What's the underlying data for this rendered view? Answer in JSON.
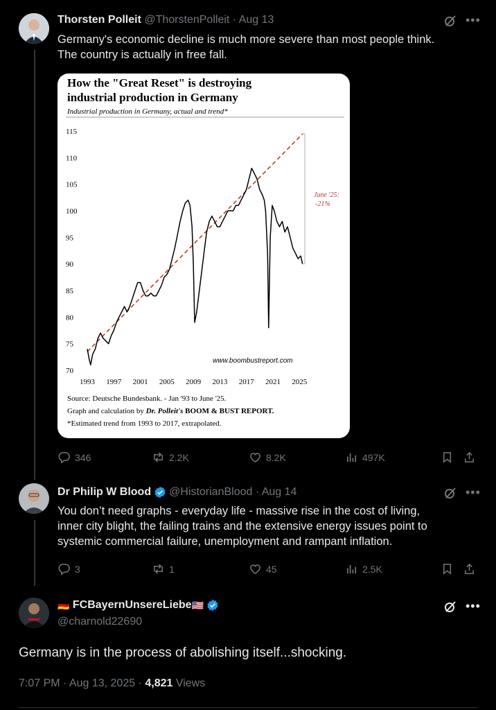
{
  "tweet1": {
    "name": "Thorsten Polleit",
    "handle": "@ThorstenPolleit",
    "date": "· Aug 13",
    "text_line1": "Germany's economic decline is much more severe than most people think.",
    "text_line2": "The country is actually in free fall.",
    "replies": "346",
    "reposts": "2.2K",
    "likes": "8.2K",
    "views": "497K"
  },
  "chart": {
    "title_line1": "How the \"Great Reset\" is destroying",
    "title_line2": "industrial production in Germany",
    "subtitle": "Industrial production in Germany, actual and trend*",
    "annotation_line1": "June '25:",
    "annotation_line2": "-21%",
    "watermark": "www.boombustreport.com",
    "source_line1": "Source: Deutsche Bundesbank. - Jan '93 to June '25.",
    "source_line2_prefix": "Graph and calculation by ",
    "source_line2_author": "Dr. Polleit's",
    "source_line2_report": " BOOM & BUST REPORT.",
    "source_line3": "*Estimated trend from 1993 to 2017, extrapolated."
  },
  "chart_data": {
    "type": "line",
    "title": "How the \"Great Reset\" is destroying industrial production in Germany",
    "subtitle": "Industrial production in Germany, actual and trend*",
    "xlabel": "",
    "ylabel": "",
    "xlim": [
      1993,
      2025.6
    ],
    "ylim": [
      70,
      115
    ],
    "x_ticks": [
      "1993",
      "1997",
      "2001",
      "2005",
      "2009",
      "2013",
      "2017",
      "2021",
      "2025"
    ],
    "y_ticks": [
      "115",
      "110",
      "105",
      "100",
      "95",
      "90",
      "85",
      "80",
      "75",
      "70"
    ],
    "grid": false,
    "series": [
      {
        "values_xy": [
          [
            1993.0,
            74
          ],
          [
            1993.3,
            72
          ],
          [
            1993.5,
            71
          ],
          [
            1993.8,
            73
          ],
          [
            1994.2,
            74
          ],
          [
            1994.6,
            76
          ],
          [
            1995.0,
            77
          ],
          [
            1995.4,
            76
          ],
          [
            1995.8,
            75.5
          ],
          [
            1996.2,
            75
          ],
          [
            1996.6,
            76.5
          ],
          [
            1997.0,
            77.5
          ],
          [
            1997.4,
            79
          ],
          [
            1997.8,
            80
          ],
          [
            1998.2,
            81
          ],
          [
            1998.6,
            82
          ],
          [
            1999.0,
            81
          ],
          [
            1999.4,
            82
          ],
          [
            1999.8,
            83.5
          ],
          [
            2000.2,
            85
          ],
          [
            2000.6,
            86.5
          ],
          [
            2001.0,
            86.5
          ],
          [
            2001.4,
            85
          ],
          [
            2001.8,
            84
          ],
          [
            2002.2,
            84
          ],
          [
            2002.6,
            84.5
          ],
          [
            2003.0,
            84
          ],
          [
            2003.4,
            84
          ],
          [
            2003.8,
            85
          ],
          [
            2004.2,
            86
          ],
          [
            2004.6,
            87.5
          ],
          [
            2005.0,
            88
          ],
          [
            2005.4,
            89
          ],
          [
            2005.8,
            91
          ],
          [
            2006.2,
            93
          ],
          [
            2006.6,
            95.5
          ],
          [
            2007.0,
            98
          ],
          [
            2007.4,
            100
          ],
          [
            2007.8,
            101.5
          ],
          [
            2008.2,
            102
          ],
          [
            2008.5,
            101
          ],
          [
            2008.8,
            97
          ],
          [
            2009.0,
            90
          ],
          [
            2009.2,
            79
          ],
          [
            2009.5,
            81
          ],
          [
            2009.8,
            84
          ],
          [
            2010.2,
            88
          ],
          [
            2010.6,
            92
          ],
          [
            2011.0,
            96
          ],
          [
            2011.4,
            98
          ],
          [
            2011.8,
            99
          ],
          [
            2012.2,
            98
          ],
          [
            2012.6,
            97
          ],
          [
            2013.0,
            97
          ],
          [
            2013.4,
            98
          ],
          [
            2013.8,
            99
          ],
          [
            2014.2,
            100
          ],
          [
            2014.6,
            100
          ],
          [
            2015.0,
            100
          ],
          [
            2015.4,
            101
          ],
          [
            2015.8,
            101
          ],
          [
            2016.2,
            102
          ],
          [
            2016.6,
            103
          ],
          [
            2017.0,
            104
          ],
          [
            2017.4,
            106
          ],
          [
            2017.8,
            108
          ],
          [
            2018.2,
            107
          ],
          [
            2018.6,
            106
          ],
          [
            2019.0,
            104
          ],
          [
            2019.4,
            103
          ],
          [
            2019.7,
            102
          ],
          [
            2019.9,
            100
          ],
          [
            2020.2,
            92
          ],
          [
            2020.35,
            78
          ],
          [
            2020.6,
            95
          ],
          [
            2020.9,
            101
          ],
          [
            2021.2,
            100
          ],
          [
            2021.6,
            98
          ],
          [
            2022.0,
            97
          ],
          [
            2022.4,
            98
          ],
          [
            2022.8,
            96
          ],
          [
            2023.2,
            97
          ],
          [
            2023.6,
            95
          ],
          [
            2024.0,
            93
          ],
          [
            2024.4,
            92
          ],
          [
            2024.8,
            91
          ],
          [
            2025.2,
            91.5
          ],
          [
            2025.45,
            90
          ]
        ]
      },
      {
        "style": "dashed",
        "values_xy": [
          [
            1993.0,
            73.5
          ],
          [
            2025.5,
            114.5
          ]
        ]
      }
    ],
    "annotations": [
      "June '25:",
      "-21%"
    ]
  },
  "tweet2": {
    "name": "Dr Philip W Blood",
    "handle": "@HistorianBlood",
    "date": "· Aug 14",
    "text_line1": "You don’t need graphs - everyday life - massive rise in the cost of living,",
    "text_line2": "inner city blight, the failing trains and the extensive energy issues point to",
    "text_line3": "systemic commercial failure, unemployment and rampant inflation.",
    "replies": "3",
    "reposts": "1",
    "likes": "45",
    "views": "2.5K"
  },
  "tweet3": {
    "name": "FCBayernUnsereLiebe",
    "flag_left": "🇩🇪",
    "flag_right": "🇺🇸",
    "handle": "@charnold22690",
    "text": "Germany is in the process of abolishing itself...shocking.",
    "time": "7:07 PM · Aug 13, 2025 ·",
    "views_count": "4,821",
    "views_label": "Views"
  },
  "colors": {
    "background": "#000000",
    "text": "#e7e9ea",
    "muted": "#71767b",
    "verified": "#1d9bf0",
    "trend": "#c0392b"
  },
  "icons": [
    "reply-icon",
    "repost-icon",
    "like-icon",
    "views-icon",
    "bookmark-icon",
    "share-icon",
    "grok-icon",
    "more-icon",
    "verified-icon"
  ]
}
